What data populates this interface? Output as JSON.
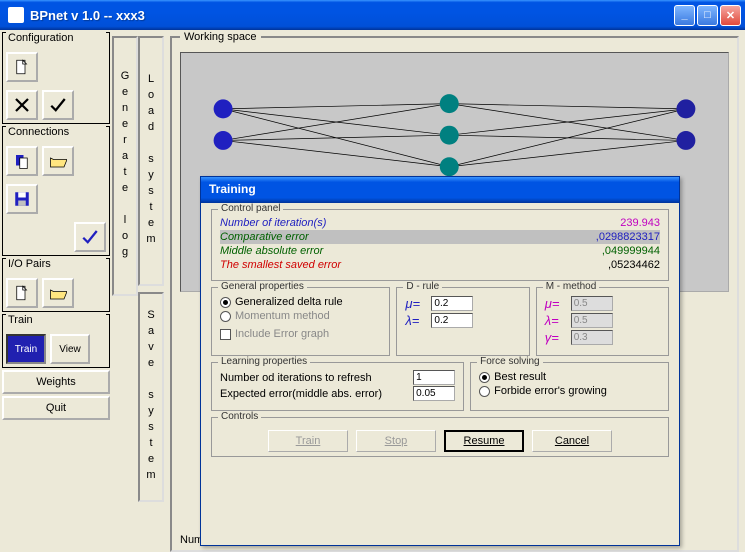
{
  "window": {
    "title": "BPnet v 1.0   --   xxx3"
  },
  "sidebar": {
    "configuration": {
      "label": "Configuration"
    },
    "connections": {
      "label": "Connections"
    },
    "iopairs": {
      "label": "I/O Pairs"
    },
    "train": {
      "label": "Train",
      "train_btn": "Train",
      "view_btn": "View"
    },
    "weights_btn": "Weights",
    "quit_btn": "Quit"
  },
  "vertical": {
    "generate": "Generate log",
    "load": "Load system",
    "save": "Save system"
  },
  "workspace": {
    "label": "Working space",
    "status_label": "Number o"
  },
  "dialog": {
    "title": "Training",
    "control": {
      "label": "Control panel",
      "iter_label": "Number of iteration(s)",
      "iter_val": "239.943",
      "comp_label": "Comparative error",
      "comp_val": ",0298823317",
      "mid_label": "Middle absolute error",
      "mid_val": ",049999944",
      "sml_label": "The smallest saved error",
      "sml_val": ",05234462"
    },
    "general": {
      "label": "General properties",
      "gen_delta": "Generalized delta rule",
      "momentum": "Momentum method",
      "include_err": "Include Error graph"
    },
    "drule": {
      "label": "D - rule",
      "mu_sym": "μ=",
      "mu_val": "0.2",
      "lambda_sym": "λ=",
      "lambda_val": "0.2"
    },
    "mmethod": {
      "label": "M - method",
      "mu_sym": "μ=",
      "mu_val": "0.5",
      "lambda_sym": "λ=",
      "lambda_val": "0.5",
      "gamma_sym": "γ=",
      "gamma_val": "0.3"
    },
    "learning": {
      "label": "Learning properties",
      "refresh_label": "Number od iterations to refresh",
      "refresh_val": "1",
      "expected_label": "Expected error(middle abs. error)",
      "expected_val": "0.05"
    },
    "force": {
      "label": "Force solving",
      "best": "Best result",
      "forbide": "Forbide error's growing"
    },
    "controls": {
      "label": "Controls"
    },
    "buttons": {
      "train": "Train",
      "stop": "Stop",
      "resume": "Resume",
      "cancel": "Cancel"
    }
  }
}
